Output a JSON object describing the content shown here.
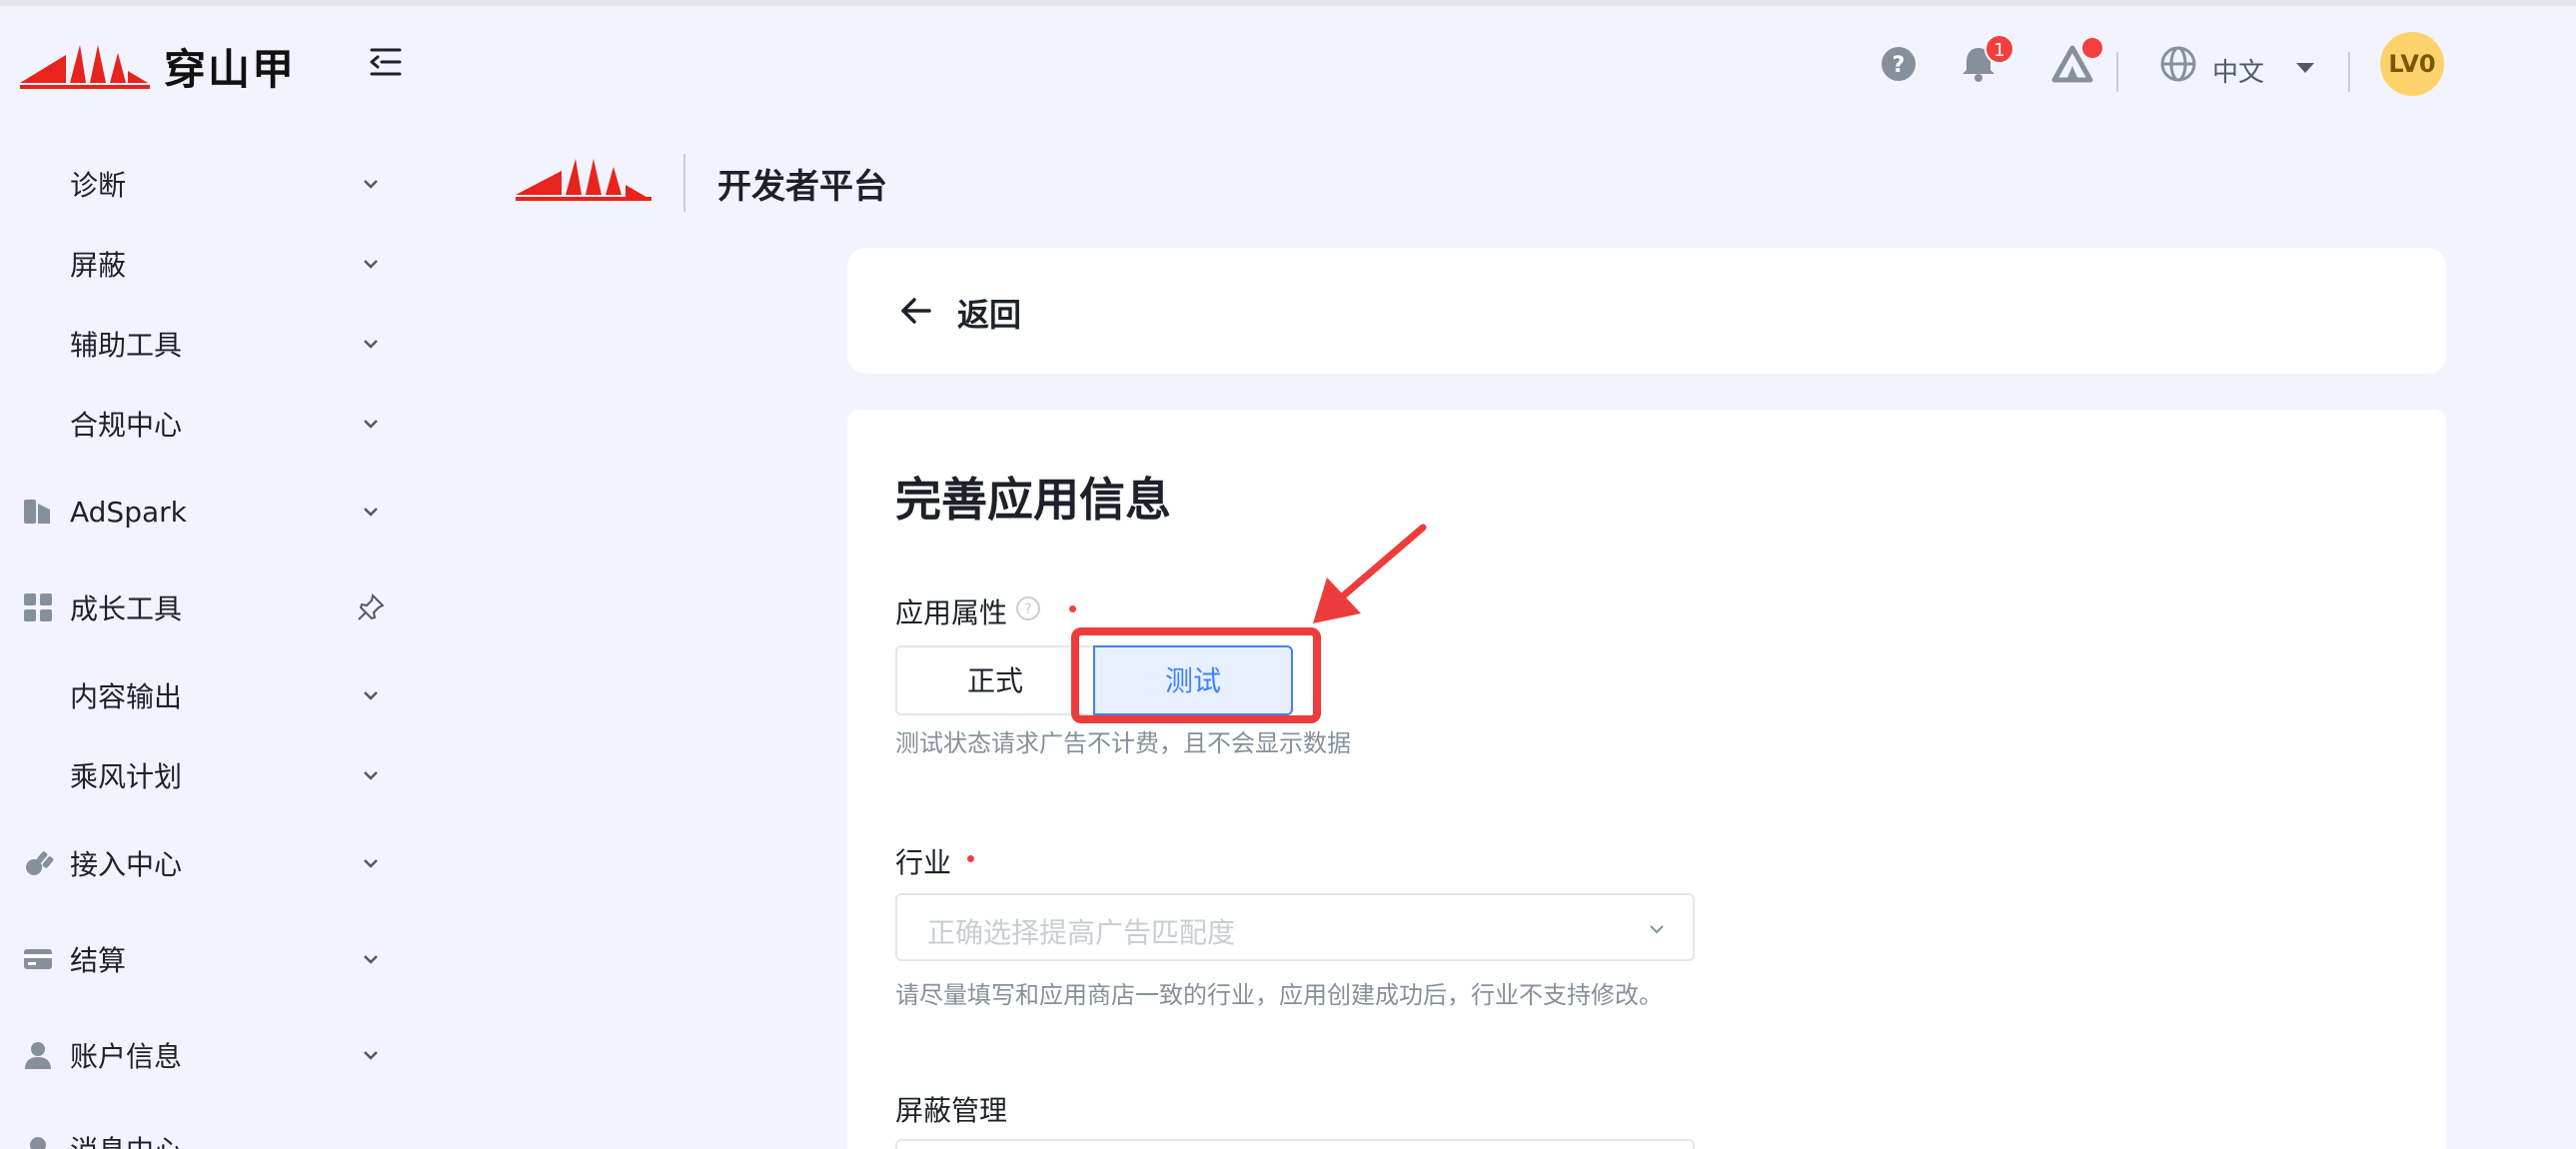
{
  "header": {
    "logo_text": "穿山甲",
    "badge_count": "1",
    "language": "中文",
    "avatar_text": "LV0"
  },
  "sidebar": {
    "items": [
      {
        "label": "诊断",
        "icon": "none"
      },
      {
        "label": "屏蔽",
        "icon": "none"
      },
      {
        "label": "辅助工具",
        "icon": "none"
      },
      {
        "label": "合规中心",
        "icon": "none"
      },
      {
        "label": "AdSpark",
        "icon": "adspark-icon"
      },
      {
        "label": "成长工具",
        "icon": "grid-icon"
      },
      {
        "label": "内容输出",
        "icon": "none"
      },
      {
        "label": "乘风计划",
        "icon": "none"
      },
      {
        "label": "接入中心",
        "icon": "plug-icon"
      },
      {
        "label": "结算",
        "icon": "card-icon"
      },
      {
        "label": "账户信息",
        "icon": "user-icon"
      },
      {
        "label": "消息中心",
        "icon": "message-icon"
      }
    ]
  },
  "main": {
    "platform_title": "开发者平台",
    "back_label": "返回",
    "form_title": "完善应用信息",
    "app_attr": {
      "label": "应用属性",
      "options": [
        "正式",
        "测试"
      ],
      "selected": "测试",
      "hint": "测试状态请求广告不计费，且不会显示数据"
    },
    "industry": {
      "label": "行业",
      "placeholder": "正确选择提高广告匹配度",
      "hint": "请尽量填写和应用商店一致的行业，应用创建成功后，行业不支持修改。"
    },
    "block_mgmt": {
      "label": "屏蔽管理"
    }
  },
  "colors": {
    "brand_red": "#e8231b",
    "accent_blue": "#4080ff",
    "annotation_red": "#ee3b3b"
  }
}
